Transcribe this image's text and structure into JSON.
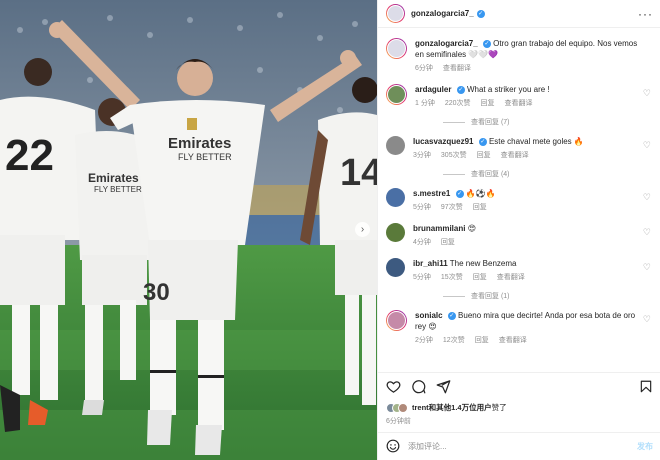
{
  "post": {
    "author": "gonzalogarcia7_",
    "more_label": "···"
  },
  "comments": [
    {
      "user": "gonzalogarcia7_",
      "text": "Otro gran trabajo del equipo. Nos vemos en semifinales 🤍🤍💜",
      "time": "6分钟",
      "likes": "",
      "reply": "查看翻译",
      "extra": "",
      "avatar_color": "#dcdce8",
      "heart": false
    },
    {
      "user": "ardaguler",
      "text": "What a striker you are !",
      "time": "1 分钟",
      "likes": "220次赞",
      "reply": "回复",
      "extra": "查看翻译",
      "avatar_color": "#6f8f5a",
      "heart": true,
      "view_replies": "查看回复 (7)"
    },
    {
      "user": "lucasvazquez91",
      "text": "Este chaval mete goles 🔥",
      "time": "3分钟",
      "likes": "305次赞",
      "reply": "回复",
      "extra": "查看翻译",
      "avatar_color": "#8a8a8a",
      "heart": true,
      "view_replies": "查看回复 (4)"
    },
    {
      "user": "s.mestre1",
      "text": "🔥⚽🔥",
      "time": "5分钟",
      "likes": "97次赞",
      "reply": "回复",
      "extra": "",
      "avatar_color": "#4a6fa5",
      "heart": true
    },
    {
      "user": "brunammilani",
      "text": "😍",
      "time": "4分钟",
      "likes": "",
      "reply": "回复",
      "extra": "",
      "avatar_color": "#5a7a3a",
      "heart": true
    },
    {
      "user": "ibr_ahi11",
      "text": "The new Benzema",
      "time": "5分钟",
      "likes": "15次赞",
      "reply": "回复",
      "extra": "查看翻译",
      "avatar_color": "#3d5a80",
      "heart": true,
      "view_replies": "查看回复 (1)"
    },
    {
      "user": "sonialc",
      "text": "Bueno mira que decirte! Anda por esa bota de oro rey 😍",
      "time": "2分钟",
      "likes": "12次赞",
      "reply": "回复",
      "extra": "查看翻译",
      "avatar_color": "#c58aa8",
      "heart": true
    }
  ],
  "likes_summary": {
    "first_user": "trent",
    "rest": "和其他1.4万位用户",
    "suffix": "赞了"
  },
  "post_time": "6分钟前",
  "add_comment": {
    "placeholder": "添加评论...",
    "post_label": "发布"
  },
  "icons": {
    "heart": "heart-icon",
    "comment": "comment-icon",
    "share": "share-icon",
    "bookmark": "bookmark-icon",
    "emoji": "emoji-icon",
    "more": "more-icon",
    "next": "chevron-right-icon"
  },
  "colors": {
    "verified": "#3897f0",
    "grass": "#3f8a3c",
    "muted": "#8e8e8e",
    "post_button": "#b2dffc"
  }
}
